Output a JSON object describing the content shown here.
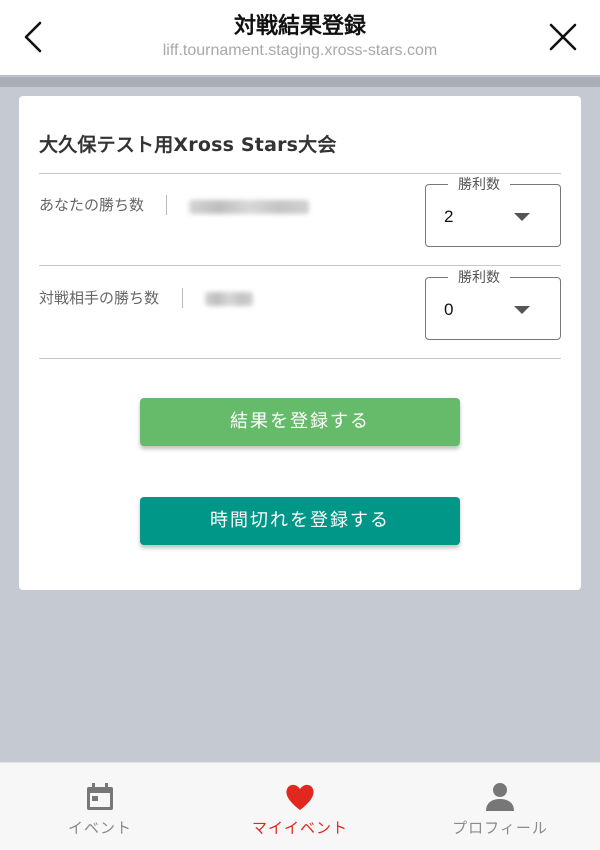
{
  "header": {
    "title": "対戦結果登録",
    "url": "liff.tournament.staging.xross-stars.com"
  },
  "card": {
    "tournament_name": "大久保テスト用Xross Stars大会",
    "rows": [
      {
        "label": "あなたの勝ち数",
        "select_legend": "勝利数",
        "value": "2"
      },
      {
        "label": "対戦相手の勝ち数",
        "select_legend": "勝利数",
        "value": "0"
      }
    ],
    "submit_label": "結果を登録する",
    "timeout_label": "時間切れを登録する"
  },
  "bottom_nav": {
    "items": [
      {
        "label": "イベント",
        "icon": "calendar-icon",
        "active": false
      },
      {
        "label": "マイイベント",
        "icon": "heart-icon",
        "active": true
      },
      {
        "label": "プロフィール",
        "icon": "person-icon",
        "active": false
      }
    ]
  },
  "colors": {
    "submit_button": "#66bb6a",
    "timeout_button": "#009688",
    "active_tab": "#e0281e",
    "background": "#c5c9d1"
  }
}
